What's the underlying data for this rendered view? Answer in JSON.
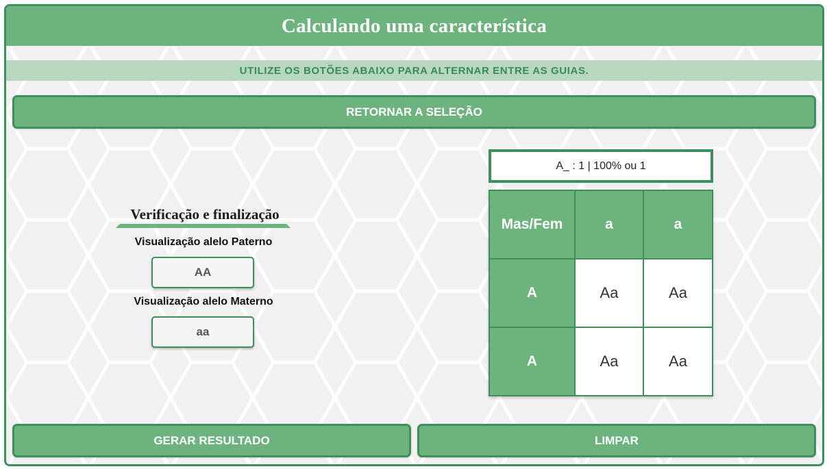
{
  "header": {
    "title": "Calculando uma característica"
  },
  "instruction": "UTILIZE OS BOTÕES ABAIXO PARA ALTERNAR ENTRE AS GUIAS.",
  "buttons": {
    "return_label": "RETORNAR A SELEÇÃO",
    "generate_label": "GERAR RESULTADO",
    "clear_label": "LIMPAR"
  },
  "verification": {
    "title": "Verificação e finalização",
    "paternal_label": "Visualização alelo Paterno",
    "paternal_value": "AA",
    "maternal_label": "Visualização alelo Materno",
    "maternal_value": "aa"
  },
  "result": {
    "text": "A_ : 1 | 100% ou 1"
  },
  "punnett": {
    "corner": "Mas/Fem",
    "columns": [
      "a",
      "a"
    ],
    "rows": [
      {
        "header": "A",
        "cells": [
          "Aa",
          "Aa"
        ]
      },
      {
        "header": "A",
        "cells": [
          "Aa",
          "Aa"
        ]
      }
    ]
  },
  "colors": {
    "primary_green": "#6db37e",
    "border_green": "#3f8f5c",
    "instruction_bg": "#b7d7bf",
    "instruction_text": "#3a8a5a"
  }
}
